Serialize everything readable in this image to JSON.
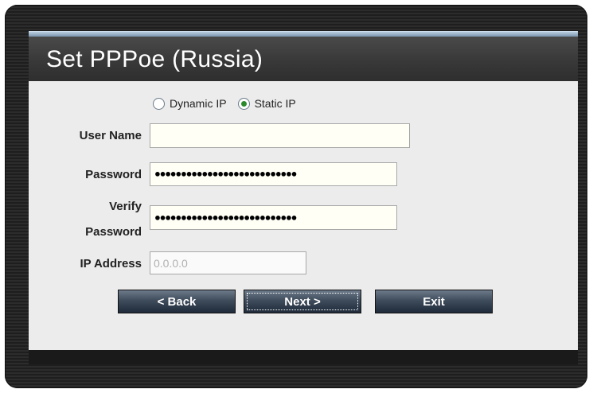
{
  "title": "Set PPPoe (Russia)",
  "ip_mode": {
    "options": [
      "Dynamic IP",
      "Static IP"
    ],
    "selected": "Static IP"
  },
  "fields": {
    "user_name_label": "User Name",
    "user_name_value": "",
    "password_label": "Password",
    "password_value": "●●●●●●●●●●●●●●●●●●●●●●●●●●●",
    "verify_label_1": "Verify",
    "verify_label_2": "Password",
    "verify_value": "●●●●●●●●●●●●●●●●●●●●●●●●●●●",
    "ip_label": "IP Address",
    "ip_value": "0.0.0.0"
  },
  "buttons": {
    "back": "< Back",
    "next": "Next >",
    "exit": "Exit"
  },
  "colors": {
    "accent": "#8ea6bf",
    "selected_radio": "#2c8a2c"
  }
}
